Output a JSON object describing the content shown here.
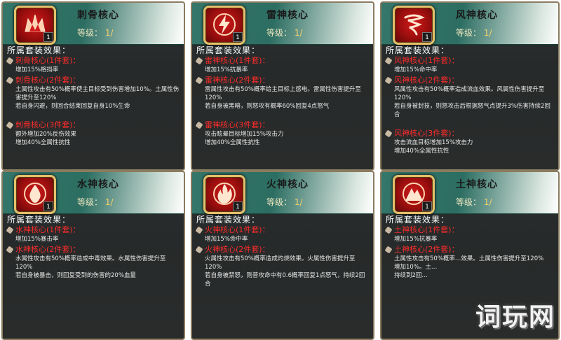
{
  "cards": [
    {
      "name": "刺骨核心",
      "level_label": "等级：",
      "level_value": "1/",
      "badge": "1",
      "section": "所属套装效果：",
      "sets": [
        {
          "title": "刺骨核心(1件套)：",
          "desc": "增加15%格挡率"
        },
        {
          "title": "刺骨核心(2件套)：",
          "desc": "土属性攻击有50%概率使主目标受到伤害增加10%。土属性伤害提升至120%\n若自身闪避，则回合结束回复自身10%生命"
        },
        {
          "title": "刺骨核心(3件套)：",
          "desc": "额外增加20%反伤效果\n增加40%全属性抗性"
        }
      ]
    },
    {
      "name": "雷神核心",
      "level_label": "等级：",
      "level_value": "1/",
      "badge": "1",
      "section": "所属套装效果：",
      "sets": [
        {
          "title": "雷神核心(1件套)：",
          "desc": "增加15%抗暴率"
        },
        {
          "title": "雷神核心(2件套)：",
          "desc": "雷属性攻击有50%概率给主目标上感电。雷属性伤害提升至120%\n若自身被黑暗，则怒攻有概率60%回复4点怒气"
        },
        {
          "title": "雷神核心(3件套)：",
          "desc": "攻击眩晕目标增加15%攻击力\n增加40%全属性抗性"
        }
      ]
    },
    {
      "name": "风神核心",
      "level_label": "等级：",
      "level_value": "1/",
      "badge": "1",
      "section": "所属套装效果：",
      "sets": [
        {
          "title": "风神核心(1件套)：",
          "desc": "增加15%命中率"
        },
        {
          "title": "风神核心(2件套)：",
          "desc": "风属性攻击有50%概率造成流血效果。风属性伤害提升至120%\n若自身被封技，则怒攻击后根据怒气点提升3%伤害持续2回合"
        },
        {
          "title": "风神核心(3件套)：",
          "desc": "攻击流血目标增加15%攻击力\n增加40%全属性抗性"
        }
      ]
    },
    {
      "name": "水神核心",
      "level_label": "等级：",
      "level_value": "1/",
      "badge": "1",
      "section": "所属套装效果：",
      "sets": [
        {
          "title": "水神核心(1件套)：",
          "desc": "增加15%暴击率"
        },
        {
          "title": "水神核心(2件套)：",
          "desc": "水属性攻击有50%概率造成中毒效果。水属性伤害提升至120%\n若自身被暴击，则回复受到的伤害的20%血量"
        }
      ]
    },
    {
      "name": "火神核心",
      "level_label": "等级：",
      "level_value": "1/",
      "badge": "1",
      "section": "所属套装效果：",
      "sets": [
        {
          "title": "火神核心(1件套)：",
          "desc": "增加15%命中率"
        },
        {
          "title": "火神核心(2件套)：",
          "desc": "火属性攻击有50%概率造成灼烧效果。火属性伤害提升至120%\n若自身被禁怒，则普攻命中有0.6概率回复1点怒气，持续2回合"
        }
      ]
    },
    {
      "name": "土神核心",
      "level_label": "等级：",
      "level_value": "1/",
      "badge": "1",
      "section": "所属套装效果：",
      "sets": [
        {
          "title": "土神核心(1件套)：",
          "desc": "增加15%抗暴率"
        },
        {
          "title": "土神核心(2件套)：",
          "desc": "土属性攻击有50%概率…效果。土属性伤害提升至120%\n增加10%。土…\n持续到2回…"
        }
      ]
    }
  ],
  "watermark": "词玩网",
  "colors": {
    "header_teal": "#2d6e62",
    "set_title_red": "#ff2b2b",
    "level_gold": "#f3d26a",
    "card_bg": "#2a2c2c",
    "frame_gold": "#e4c06a"
  }
}
